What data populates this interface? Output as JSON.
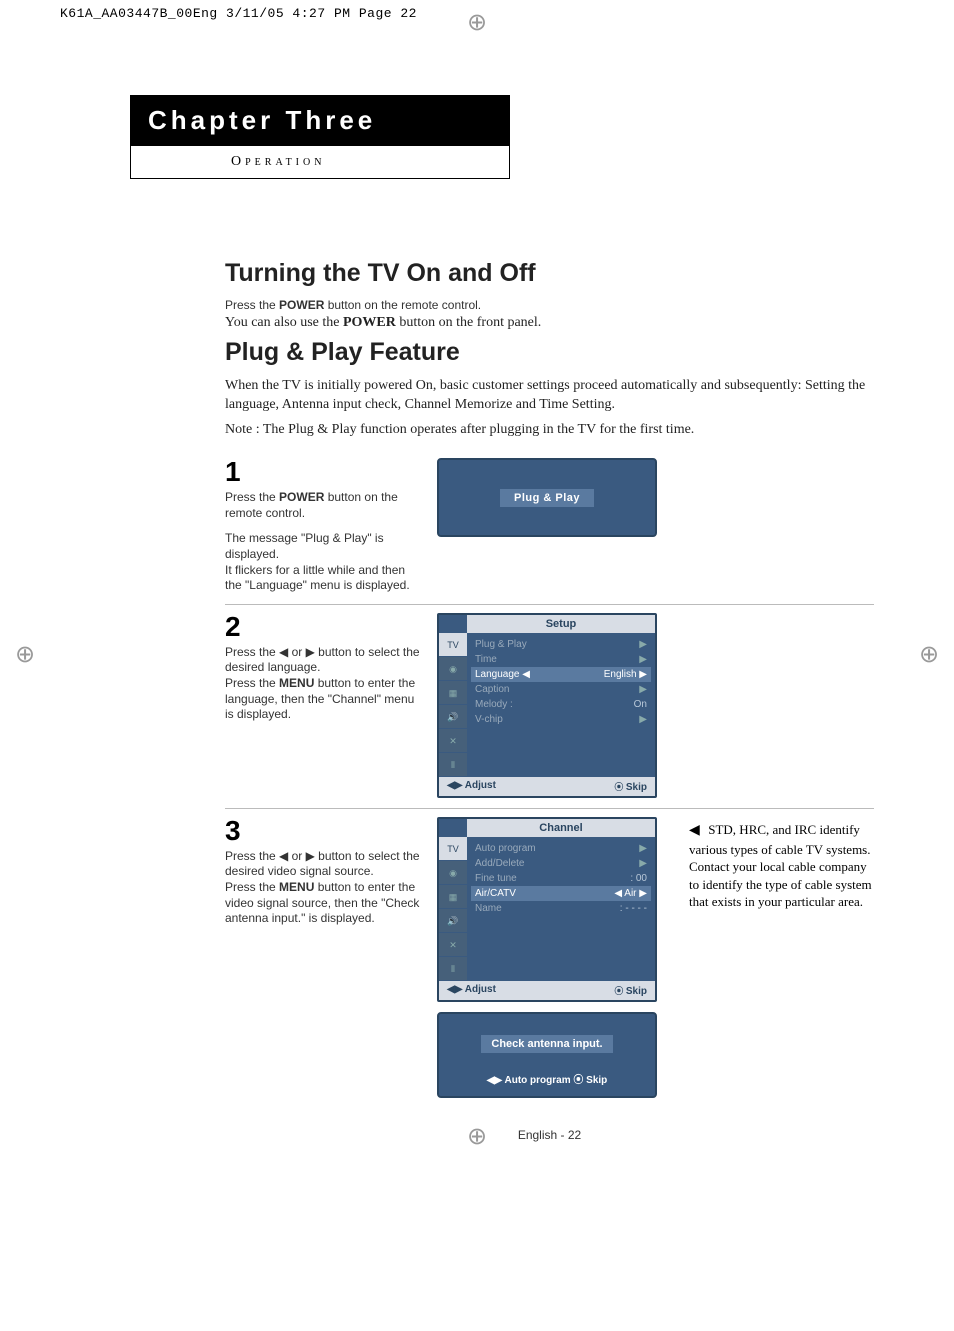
{
  "print": {
    "header": "K61A_AA03447B_00Eng  3/11/05  4:27 PM  Page 22"
  },
  "chapter": {
    "title": "Chapter Three",
    "sub": "Operation"
  },
  "section1": {
    "heading": "Turning the TV On and Off",
    "line1_pre": "Press the ",
    "line1_bold": "POWER",
    "line1_post": " button on the remote control.",
    "line2_pre": "You can also use the ",
    "line2_bold": "POWER",
    "line2_post": " button on the front panel."
  },
  "section2": {
    "heading": "Plug & Play Feature",
    "intro": "When the TV is initially powered On, basic customer settings proceed automatically and subsequently: Setting the language, Antenna input check, Channel Memorize and Time Setting.",
    "note": "Note : The Plug & Play function operates after plugging in the TV for the first time."
  },
  "steps": {
    "s1": {
      "num": "1",
      "text1_pre": "Press the ",
      "text1_bold": "POWER",
      "text1_post": " button on the remote control.",
      "text2": "The message \"Plug & Play\" is displayed.",
      "text3": "It flickers for a little while and then the \"Language\" menu is displayed.",
      "screen_label": "Plug & Play"
    },
    "s2": {
      "num": "2",
      "text1": "Press the ◀ or ▶ button to select the desired language.",
      "text2_pre": "Press the ",
      "text2_bold": "MENU",
      "text2_post": " button to enter the language, then the \"Channel\" menu is displayed.",
      "menu": {
        "title": "Setup",
        "items": [
          {
            "label": "Plug & Play",
            "val": "",
            "arrow": "▶"
          },
          {
            "label": "Time",
            "val": "",
            "arrow": "▶"
          },
          {
            "label": "Language ◀",
            "val": "English",
            "arrow": "▶",
            "sel": true
          },
          {
            "label": "Caption",
            "val": "",
            "arrow": "▶"
          },
          {
            "label": "Melody   :",
            "val": "On",
            "arrow": ""
          },
          {
            "label": "V-chip",
            "val": "",
            "arrow": "▶"
          }
        ],
        "footer_l": "Adjust",
        "footer_r": "Skip"
      }
    },
    "s3": {
      "num": "3",
      "text1": "Press the ◀ or ▶ button to select the desired video signal source.",
      "text2_pre": "Press the ",
      "text2_bold": "MENU",
      "text2_post": " button to enter the video signal source, then the \"Check antenna input.\" is displayed.",
      "menu": {
        "title": "Channel",
        "items": [
          {
            "label": "Auto program",
            "val": "",
            "arrow": "▶"
          },
          {
            "label": "Add/Delete",
            "val": "",
            "arrow": "▶"
          },
          {
            "label": "Fine tune",
            "val": ":   00",
            "arrow": ""
          },
          {
            "label": "Air/CATV",
            "val": "◀   Air",
            "arrow": "▶",
            "sel": true
          },
          {
            "label": "Name",
            "val": ":  - - - -",
            "arrow": ""
          }
        ],
        "footer_l": "Adjust",
        "footer_r": "Skip"
      },
      "check_label": "Check antenna input.",
      "check_footer_l": "Auto program",
      "check_footer_r": " ⦿ Skip",
      "side_note_marker": "◀",
      "side_note": "STD, HRC, and IRC  identify various types of cable TV systems. Contact your local cable company to identify the type of cable system that exists in your particular area."
    }
  },
  "footer": "English - 22"
}
